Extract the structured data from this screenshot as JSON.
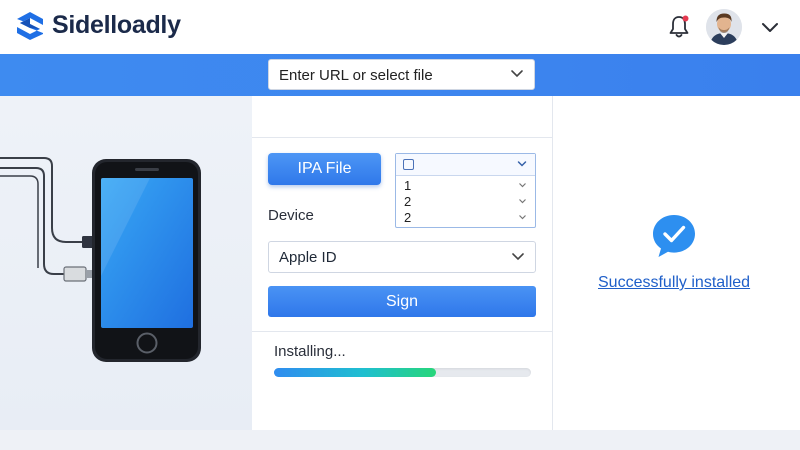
{
  "app": {
    "title": "Sidelloadly",
    "brand_color": "#1f6fe5"
  },
  "header": {
    "notification_icon": "bell-icon",
    "has_unread_notification": true,
    "menu_icon": "chevron-down-icon"
  },
  "toolbar": {
    "url_select": {
      "value": "Enter URL or select file"
    }
  },
  "form": {
    "ipa_button_label": "IPA File",
    "device_label": "Device",
    "device_dropdown": {
      "header_icon": "checkbox-icon",
      "options": [
        "1",
        "2",
        "2"
      ]
    },
    "apple_id_select": {
      "value": "Apple ID"
    },
    "sign_button_label": "Sign"
  },
  "status": {
    "installing_text": "Installing...",
    "progress": 0.63,
    "success_text": "Successfully installed",
    "success_icon": "chat-check-icon"
  },
  "colors": {
    "accent": "#3d86ef",
    "progress_start": "#2f8cf0",
    "progress_end": "#27d67a",
    "success": "#2d8ff0"
  }
}
